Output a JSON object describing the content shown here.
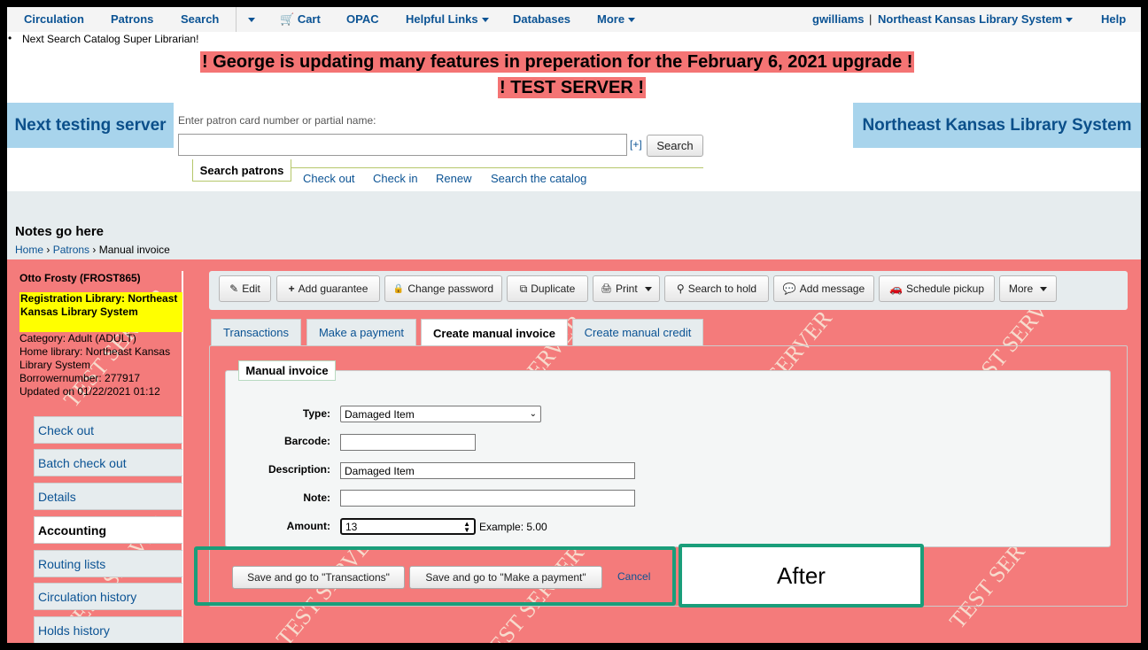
{
  "topnav": {
    "circulation": "Circulation",
    "patrons": "Patrons",
    "search": "Search",
    "cart": "Cart",
    "opac": "OPAC",
    "helpful_links": "Helpful Links",
    "databases": "Databases",
    "more": "More",
    "user": "gwilliams",
    "separator": "|",
    "library": "Northeast Kansas Library System",
    "help": "Help"
  },
  "news_item": "Next Search Catalog Super Librarian!",
  "banner": {
    "line1": "! George is updating many features in preperation for the February 6, 2021 upgrade !",
    "line2": "! TEST SERVER !"
  },
  "header": {
    "left_title": "Next testing server",
    "right_title": "Northeast Kansas Library System",
    "search_label": "Enter patron card number or partial name:",
    "search_value": "",
    "plus_link": "[+]",
    "search_button": "Search",
    "tabs": [
      "Search patrons",
      "Check out",
      "Check in",
      "Renew",
      "Search the catalog"
    ]
  },
  "notes": "Notes go here",
  "breadcrumb": {
    "home": "Home",
    "patrons": "Patrons",
    "current": "Manual invoice",
    "sep": "›"
  },
  "patron": {
    "name": "Otto Frosty (FROST865)",
    "registration_library": "Registration Library: Northeast Kansas Library System",
    "category": "Category: Adult (ADULT)",
    "home_library": "Home library: Northeast Kansas Library System",
    "borrowernumber": "Borrowernumber: 277917",
    "updated": "Updated on 01/22/2021 01:12"
  },
  "sidebar": {
    "items": [
      "Check out",
      "Batch check out",
      "Details",
      "Accounting",
      "Routing lists",
      "Circulation history",
      "Holds history"
    ],
    "active": "Accounting"
  },
  "toolbar": {
    "edit": "Edit",
    "add_guarantee": "Add guarantee",
    "change_password": "Change password",
    "duplicate": "Duplicate",
    "print": "Print",
    "search_to_hold": "Search to hold",
    "add_message": "Add message",
    "schedule_pickup": "Schedule pickup",
    "more": "More"
  },
  "tabs": [
    "Transactions",
    "Make a payment",
    "Create manual invoice",
    "Create manual credit"
  ],
  "active_tab": "Create manual invoice",
  "form": {
    "legend": "Manual invoice",
    "type_label": "Type:",
    "type_value": "Damaged Item",
    "barcode_label": "Barcode:",
    "barcode_value": "",
    "description_label": "Description:",
    "description_value": "Damaged Item",
    "note_label": "Note:",
    "note_value": "",
    "amount_label": "Amount:",
    "amount_value": "13",
    "amount_example": "Example: 5.00"
  },
  "actions": {
    "save_transactions": "Save and go to \"Transactions\"",
    "save_payment": "Save and go to \"Make a payment\"",
    "cancel": "Cancel"
  },
  "annotation": "After",
  "watermark": "TEST SERVER",
  "colors": {
    "main_bg": "#f47b7b",
    "banner_bg": "#f47474",
    "header_blue": "#a8d4ec",
    "highlight_box": "#1a9e7a",
    "registration_bg": "#ffff00"
  }
}
